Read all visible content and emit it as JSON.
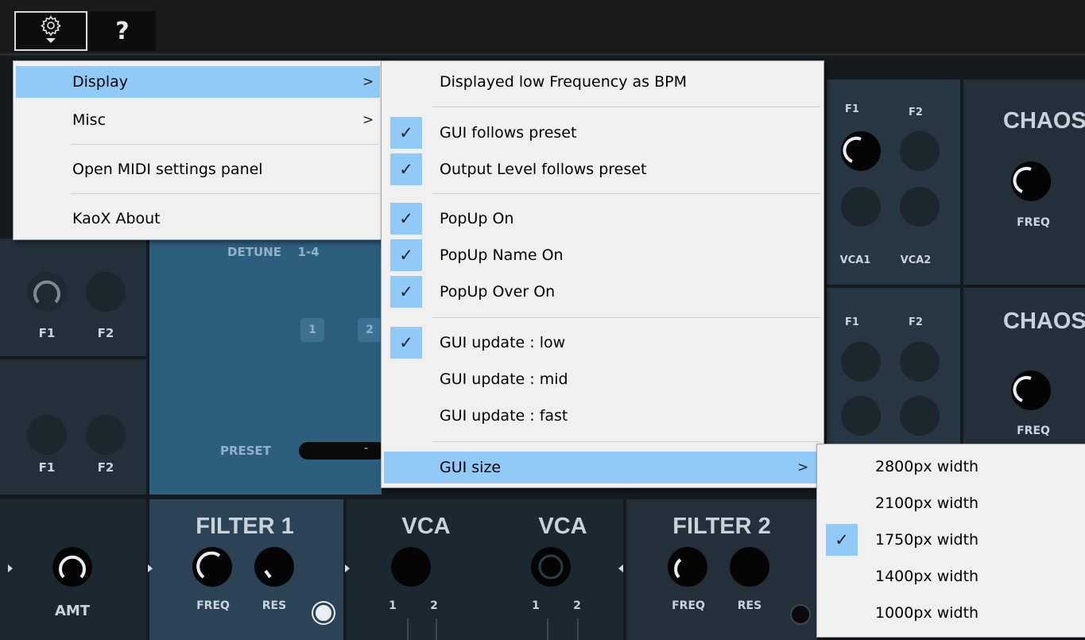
{
  "toolbar": {
    "settings_icon": "gear-icon",
    "help_label": "?"
  },
  "synth": {
    "row1": {
      "f1": "F1",
      "f2": "F2",
      "vca1": "VCA1",
      "vca2": "VCA2",
      "chaos": "CHAOS",
      "freq": "FREQ"
    },
    "row2": {
      "f1": "F1",
      "f2": "F2",
      "chaos": "CHAOS",
      "freq": "FREQ"
    },
    "left1": {
      "f1": "F1",
      "f2": "F2"
    },
    "left2": {
      "f1": "F1",
      "f2": "F2"
    },
    "detune_label": "DETUNE",
    "detune_value": "1-4",
    "step_buttons": [
      "1",
      "2"
    ],
    "preset_label": "PRESET",
    "preset_value": "-",
    "amt_label": "AMT",
    "filter1": {
      "title": "FILTER 1",
      "freq": "FREQ",
      "res": "RES"
    },
    "vca_a": {
      "title": "VCA",
      "in1": "1",
      "in2": "2"
    },
    "vca_b": {
      "title": "VCA",
      "in1": "1",
      "in2": "2"
    },
    "filter2": {
      "title": "FILTER 2",
      "freq": "FREQ",
      "res": "RES"
    }
  },
  "main_menu": {
    "items": [
      {
        "label": "Display",
        "submenu": true
      },
      {
        "label": "Misc",
        "submenu": true
      },
      {
        "label": "Open MIDI settings panel"
      },
      {
        "label": "KaoX About"
      }
    ],
    "arrow": ">"
  },
  "display_menu": {
    "items": [
      {
        "label": "Displayed low Frequency as BPM",
        "checked": false
      },
      {
        "label": "GUI follows preset",
        "checked": true
      },
      {
        "label": "Output Level follows preset",
        "checked": true
      },
      {
        "label": "PopUp On",
        "checked": true
      },
      {
        "label": "PopUp Name On",
        "checked": true
      },
      {
        "label": "PopUp Over On",
        "checked": true
      },
      {
        "label": "GUI update : low",
        "checked": true
      },
      {
        "label": "GUI update : mid",
        "checked": false
      },
      {
        "label": "GUI update : fast",
        "checked": false
      },
      {
        "label": "GUI size",
        "checked": false,
        "submenu": true
      }
    ],
    "arrow": ">",
    "check_glyph": "✓"
  },
  "size_menu": {
    "items": [
      {
        "label": "2800px width",
        "checked": false
      },
      {
        "label": "2100px width",
        "checked": false
      },
      {
        "label": "1750px width",
        "checked": true
      },
      {
        "label": "1400px width",
        "checked": false
      },
      {
        "label": "1000px width",
        "checked": false
      }
    ],
    "check_glyph": "✓"
  },
  "colors": {
    "menu_bg": "#f0f0f0",
    "menu_highlight": "#91c9f7",
    "panel_blue": "#2d5e7e",
    "panel_dark": "#233039"
  }
}
